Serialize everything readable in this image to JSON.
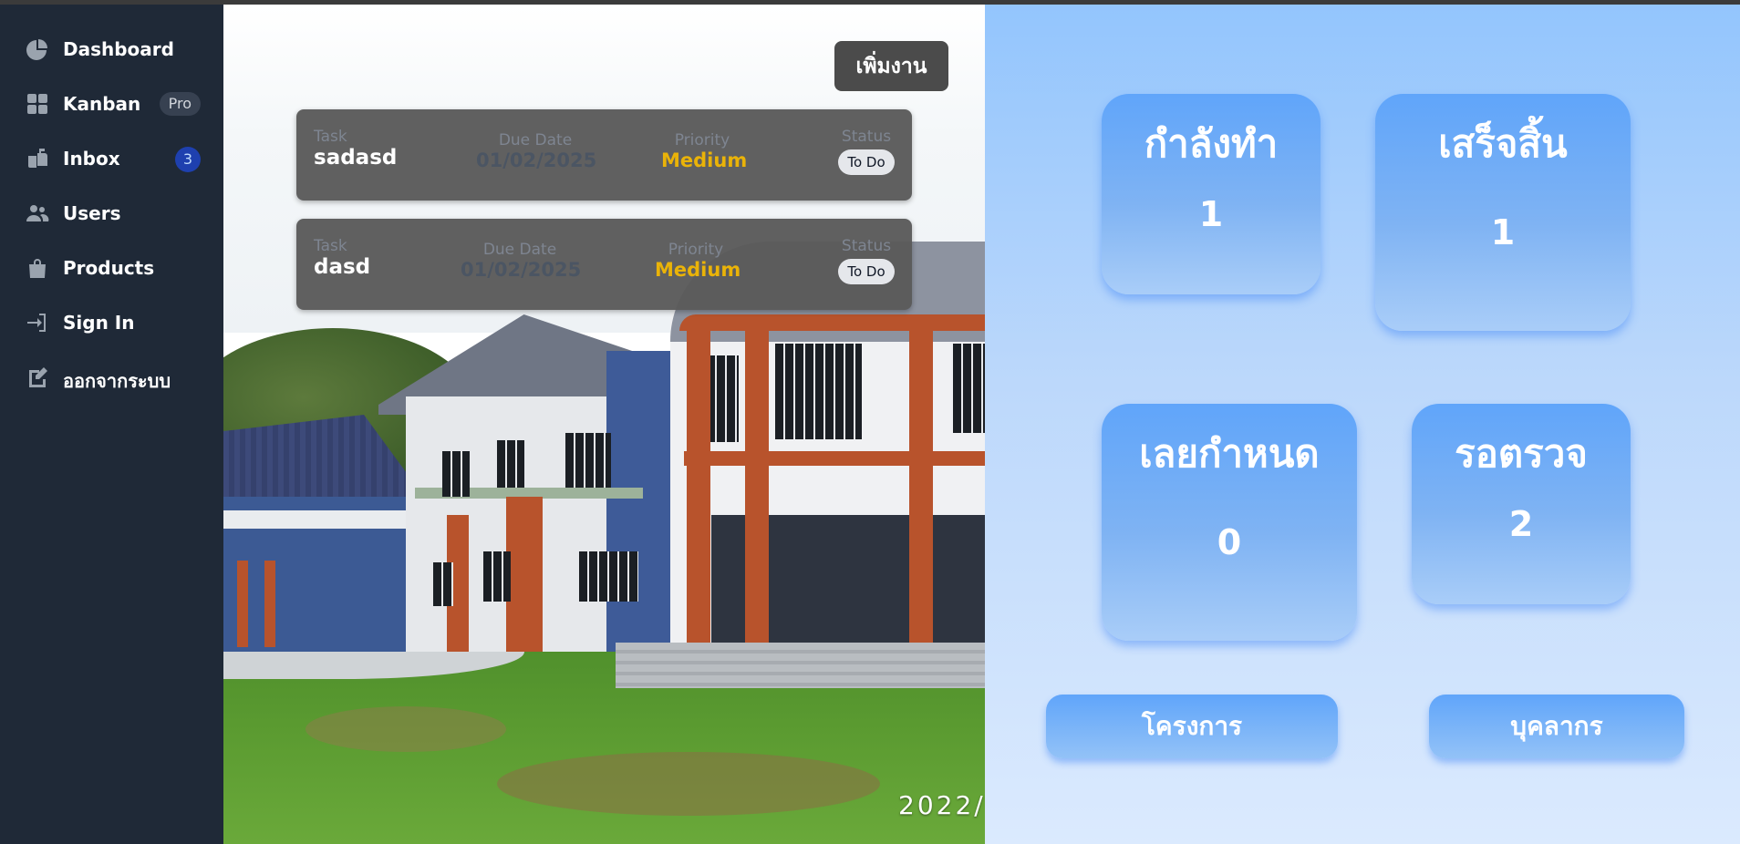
{
  "sidebar": {
    "items": [
      {
        "label": "Dashboard",
        "icon": "pie-chart-icon"
      },
      {
        "label": "Kanban",
        "icon": "grid-icon",
        "badge": "Pro"
      },
      {
        "label": "Inbox",
        "icon": "inbox-icon",
        "count": "3"
      },
      {
        "label": "Users",
        "icon": "users-icon"
      },
      {
        "label": "Products",
        "icon": "shopping-bag-icon"
      },
      {
        "label": "Sign In",
        "icon": "sign-in-icon"
      },
      {
        "label": "ออกจากระบบ",
        "icon": "sign-out-icon"
      }
    ]
  },
  "main": {
    "add_task_label": "เพิ่มงาน",
    "photo_watermark": "2022/",
    "columns": {
      "task": "Task",
      "due_date": "Due Date",
      "priority": "Priority",
      "status": "Status"
    },
    "tasks": [
      {
        "name": "sadasd",
        "due_date": "01/02/2025",
        "priority": "Medium",
        "status": "To Do"
      },
      {
        "name": "dasd",
        "due_date": "01/02/2025",
        "priority": "Medium",
        "status": "To Do"
      }
    ]
  },
  "stats": {
    "in_progress": {
      "label": "กำลังทำ",
      "value": "1"
    },
    "done": {
      "label": "เสร็จสิ้น",
      "value": "1"
    },
    "overdue": {
      "label": "เลยกำหนด",
      "value": "0"
    },
    "pending_review": {
      "label": "รอตรวจ",
      "value": "2"
    }
  },
  "actions": {
    "projects_label": "โครงการ",
    "personnel_label": "บุคลากร"
  },
  "colors": {
    "sidebar_bg": "#1f2937",
    "priority_medium": "#eab308",
    "card_blue": "#60a5fa",
    "panel_bg": "#bcd8fb"
  }
}
